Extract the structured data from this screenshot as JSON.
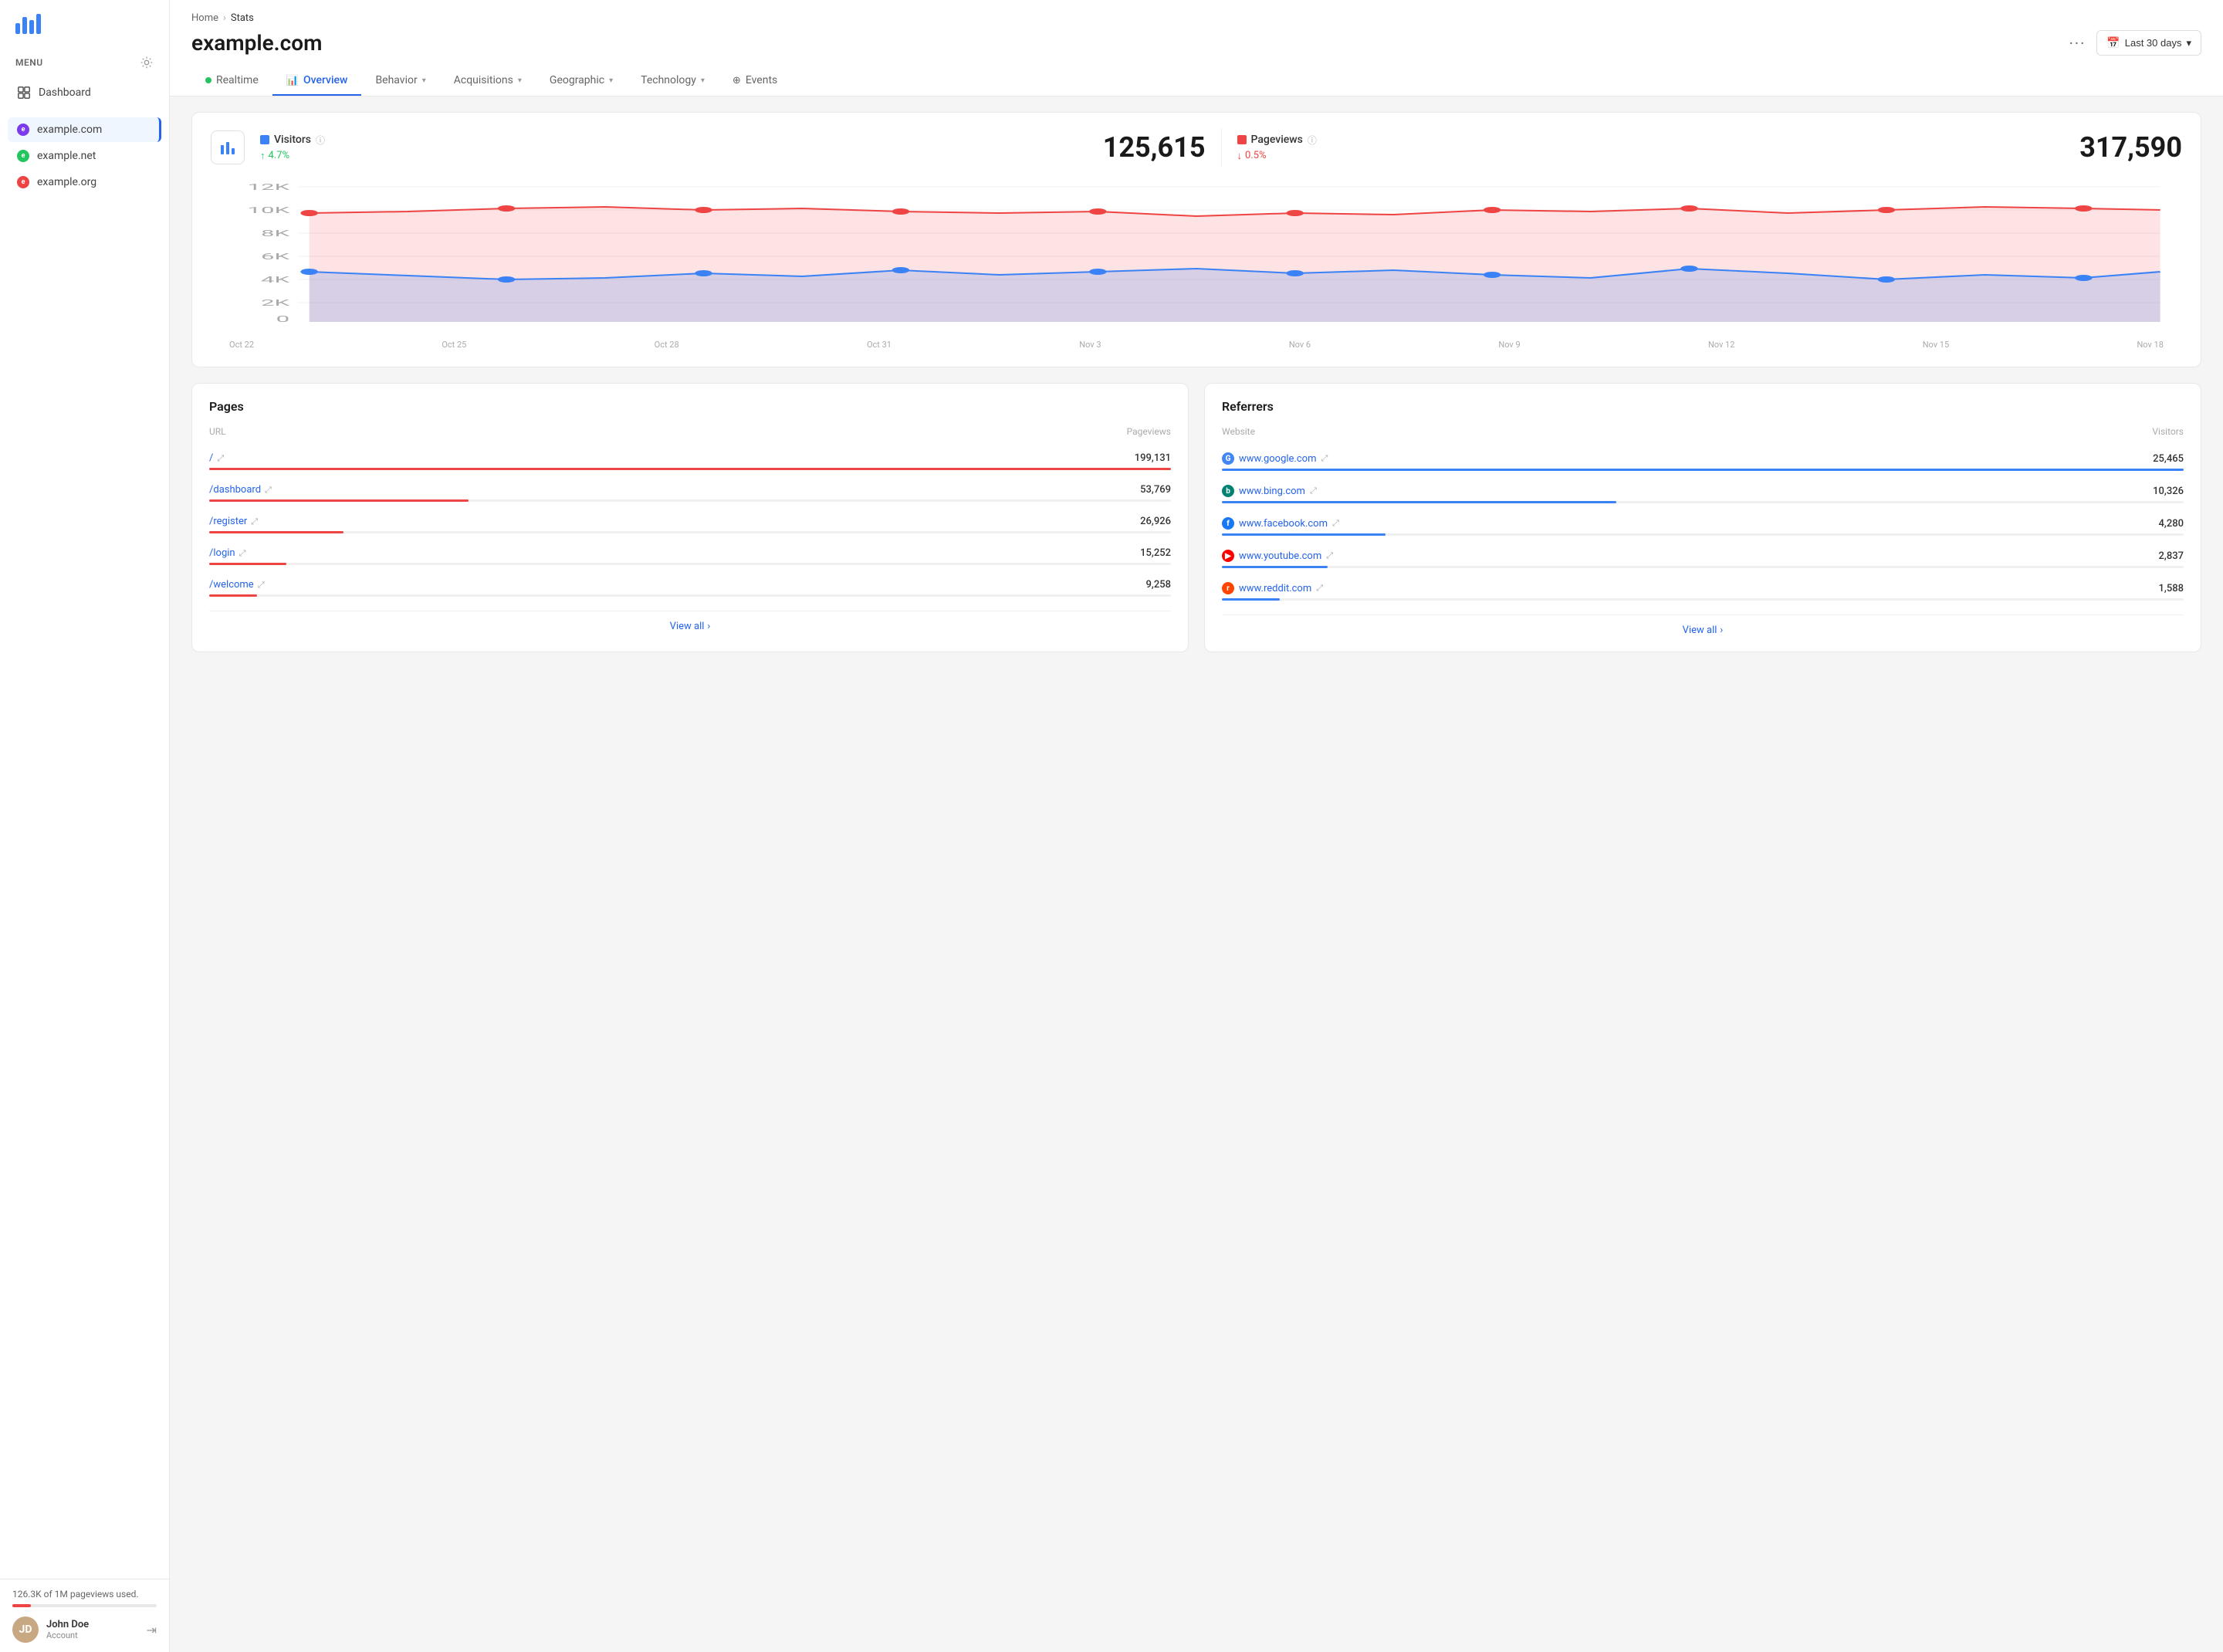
{
  "sidebar": {
    "menu_label": "MENU",
    "nav_items": [
      {
        "id": "dashboard",
        "label": "Dashboard"
      }
    ],
    "sites": [
      {
        "id": "example-com",
        "label": "example.com",
        "color": "#7c3aed",
        "active": true
      },
      {
        "id": "example-net",
        "label": "example.net",
        "color": "#22c55e",
        "active": false
      },
      {
        "id": "example-org",
        "label": "example.org",
        "color": "#ef4444",
        "active": false
      }
    ],
    "usage_text": "126.3K of 1M pageviews used.",
    "user": {
      "name": "John Doe",
      "role": "Account"
    }
  },
  "header": {
    "breadcrumb_home": "Home",
    "breadcrumb_current": "Stats",
    "title": "example.com",
    "dots": "···",
    "date_range": "Last 30 days"
  },
  "tabs": [
    {
      "id": "realtime",
      "label": "Realtime",
      "type": "dot"
    },
    {
      "id": "overview",
      "label": "Overview",
      "type": "icon",
      "active": true
    },
    {
      "id": "behavior",
      "label": "Behavior",
      "type": "dropdown"
    },
    {
      "id": "acquisitions",
      "label": "Acquisitions",
      "type": "dropdown"
    },
    {
      "id": "geographic",
      "label": "Geographic",
      "type": "dropdown"
    },
    {
      "id": "technology",
      "label": "Technology",
      "type": "dropdown"
    },
    {
      "id": "events",
      "label": "Events",
      "type": "icon"
    }
  ],
  "stats": {
    "visitors_label": "Visitors",
    "visitors_change": "4.7%",
    "visitors_change_dir": "up",
    "visitors_value": "125,615",
    "pageviews_label": "Pageviews",
    "pageviews_change": "0.5%",
    "pageviews_change_dir": "down",
    "pageviews_value": "317,590"
  },
  "chart": {
    "y_labels": [
      "12K",
      "10K",
      "8K",
      "6K",
      "4K",
      "2K",
      "0"
    ],
    "x_labels": [
      "Oct 22",
      "Oct 25",
      "Oct 28",
      "Oct 31",
      "Nov 3",
      "Nov 6",
      "Nov 9",
      "Nov 12",
      "Nov 15",
      "Nov 18"
    ]
  },
  "pages": {
    "title": "Pages",
    "col_url": "URL",
    "col_pageviews": "Pageviews",
    "rows": [
      {
        "url": "/",
        "value": "199,131",
        "bar_pct": 100
      },
      {
        "url": "/dashboard",
        "value": "53,769",
        "bar_pct": 27
      },
      {
        "url": "/register",
        "value": "26,926",
        "bar_pct": 14
      },
      {
        "url": "/login",
        "value": "15,252",
        "bar_pct": 8
      },
      {
        "url": "/welcome",
        "value": "9,258",
        "bar_pct": 5
      }
    ],
    "view_all": "View all"
  },
  "referrers": {
    "title": "Referrers",
    "col_website": "Website",
    "col_visitors": "Visitors",
    "rows": [
      {
        "name": "www.google.com",
        "value": "25,465",
        "bar_pct": 100,
        "icon_color": "#4285F4",
        "icon_letter": "G"
      },
      {
        "name": "www.bing.com",
        "value": "10,326",
        "bar_pct": 41,
        "icon_color": "#008373",
        "icon_letter": "b"
      },
      {
        "name": "www.facebook.com",
        "value": "4,280",
        "bar_pct": 17,
        "icon_color": "#1877F2",
        "icon_letter": "f"
      },
      {
        "name": "www.youtube.com",
        "value": "2,837",
        "bar_pct": 11,
        "icon_color": "#FF0000",
        "icon_letter": "▶"
      },
      {
        "name": "www.reddit.com",
        "value": "1,588",
        "bar_pct": 6,
        "icon_color": "#FF4500",
        "icon_letter": "r"
      }
    ],
    "view_all": "View all"
  }
}
